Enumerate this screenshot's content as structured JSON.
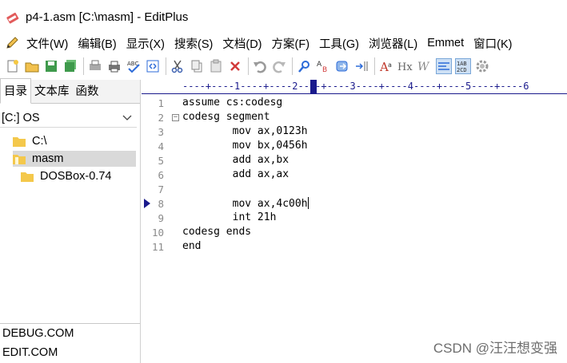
{
  "window": {
    "title": "p4-1.asm [C:\\masm] - EditPlus"
  },
  "menu": [
    "文件(W)",
    "编辑(B)",
    "显示(X)",
    "搜索(S)",
    "文档(D)",
    "方案(F)",
    "工具(G)",
    "浏览器(L)",
    "Emmet",
    "窗口(K)"
  ],
  "toolbar_icons": [
    "new-file-icon",
    "open-folder-icon",
    "save-icon",
    "save-all-icon",
    "print-preview-icon",
    "print-icon",
    "spell-check-icon",
    "html-preview-icon",
    "cut-icon",
    "copy-icon",
    "paste-icon",
    "delete-icon",
    "undo-icon",
    "redo-icon",
    "find-icon",
    "replace-icon",
    "goto-icon",
    "indent-icon",
    "font-icon",
    "hex-icon",
    "word-wrap-icon",
    "line-numbers-icon",
    "column-icon",
    "settings-icon"
  ],
  "left_panel": {
    "tabs": [
      "目录",
      "文本库",
      "函数"
    ],
    "drive": "[C:] OS",
    "tree": [
      "C:\\",
      "masm",
      "DOSBox-0.74"
    ],
    "files": [
      "DEBUG.COM",
      "EDIT.COM"
    ]
  },
  "editor": {
    "ruler": "----+----1----+----2----+----3----+----4----+----5----+----6",
    "line_numbers": [
      "1",
      "2",
      "3",
      "4",
      "5",
      "6",
      "7",
      "8",
      "9",
      "10",
      "11"
    ],
    "lines": [
      "assume cs:codesg",
      "codesg segment",
      "        mov ax,0123h",
      "        mov bx,0456h",
      "        add ax,bx",
      "        add ax,ax",
      "",
      "        mov ax,4c00h",
      "        int 21h",
      "codesg ends",
      "end"
    ],
    "fold_marker": "−"
  },
  "watermark": "CSDN @汪汪想变强",
  "colors": {
    "accent": "#1a1a8c",
    "selection": "#d9d9d9",
    "line_number": "#8a8a8a"
  }
}
